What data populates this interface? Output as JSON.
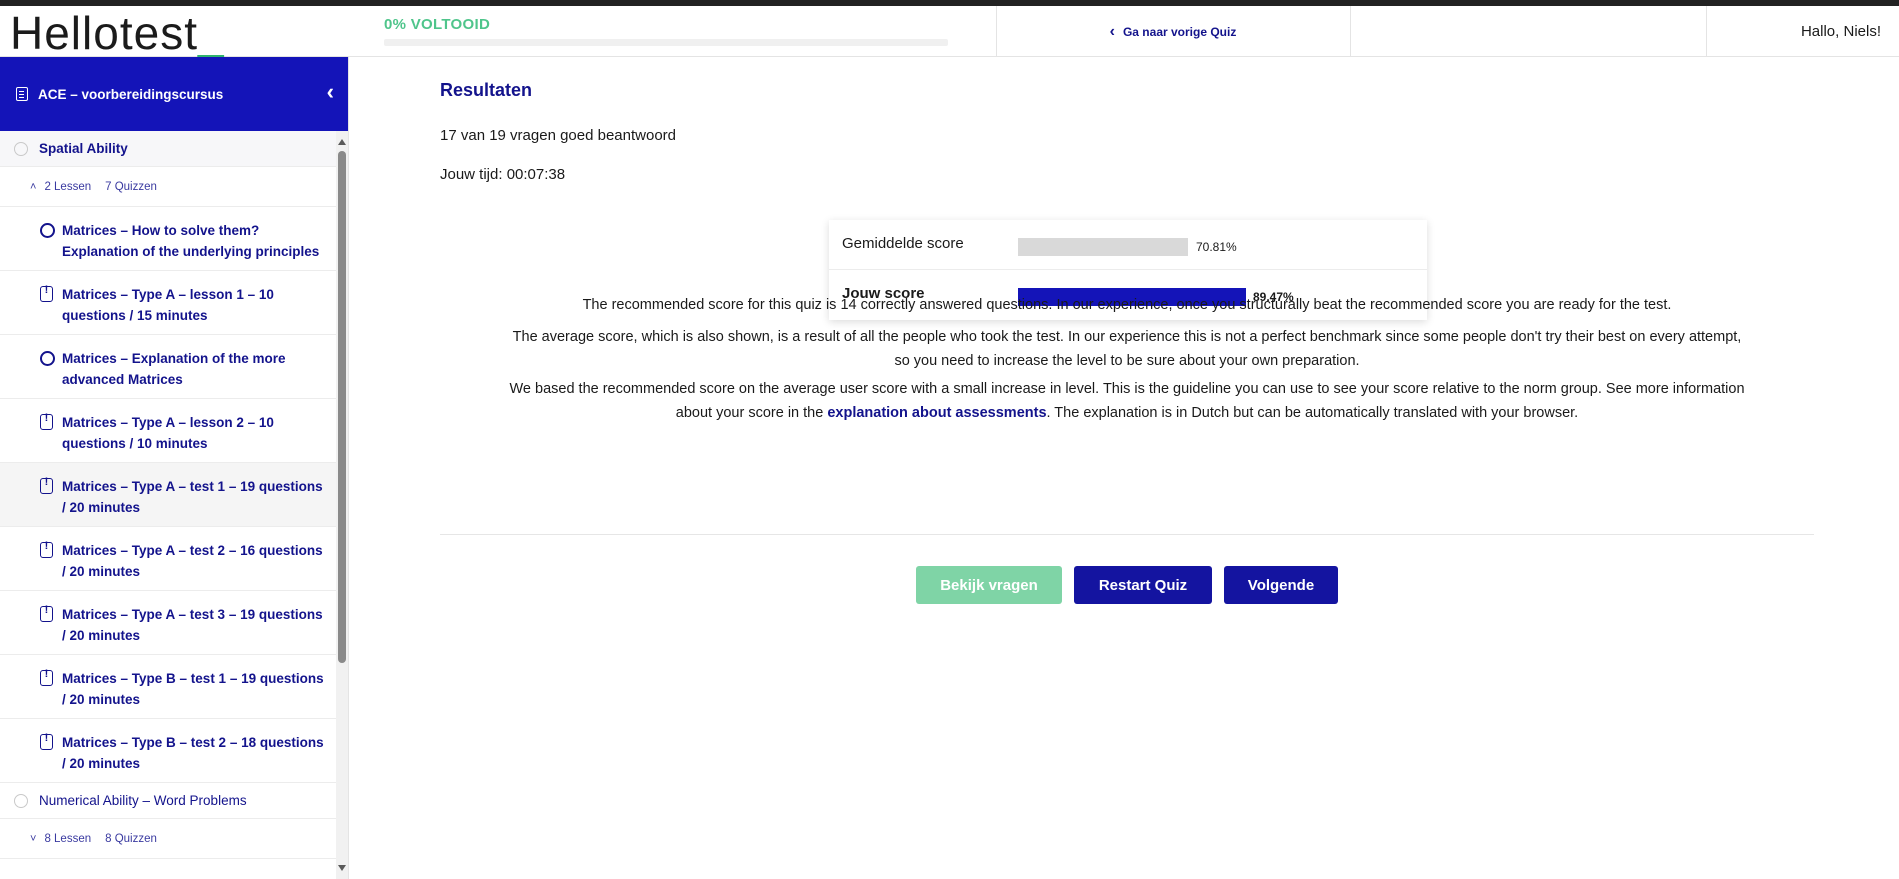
{
  "header": {
    "logo": "Hellotest",
    "logo_suffix": "_",
    "progress_label": "0% VOLTOOID",
    "progress_percent": 0,
    "prev_quiz_label": "Ga naar vorige Quiz",
    "greeting": "Hallo, Niels!"
  },
  "sidebar": {
    "course_title": "ACE – voorbereidingscursus",
    "sections": [
      {
        "title": "Spatial Ability",
        "meta_lessons": "2 Lessen",
        "meta_quizzes": "7 Quizzen",
        "items": [
          {
            "type": "lesson",
            "label": "Matrices – How to solve them? Explanation of the underlying principles"
          },
          {
            "type": "quiz",
            "label": "Matrices – Type A – lesson 1 – 10 questions / 15 minutes"
          },
          {
            "type": "lesson",
            "label": "Matrices – Explanation of the more advanced Matrices"
          },
          {
            "type": "quiz",
            "label": "Matrices – Type A – lesson 2 – 10 questions / 10 minutes"
          },
          {
            "type": "quiz",
            "label": "Matrices – Type A – test 1 – 19 questions / 20 minutes",
            "active": true
          },
          {
            "type": "quiz",
            "label": "Matrices – Type A – test 2 – 16 questions / 20 minutes"
          },
          {
            "type": "quiz",
            "label": "Matrices – Type A – test 3 – 19 questions / 20 minutes"
          },
          {
            "type": "quiz",
            "label": "Matrices – Type B – test 1 – 19 questions / 20 minutes"
          },
          {
            "type": "quiz",
            "label": "Matrices – Type B – test 2 – 18 questions / 20 minutes"
          }
        ]
      },
      {
        "title": "Numerical Ability – Word Problems",
        "meta_lessons": "8 Lessen",
        "meta_quizzes": "8 Quizzen"
      }
    ]
  },
  "results": {
    "title": "Resultaten",
    "correct_line": "17 van 19 vragen goed beantwoord",
    "time_line": "Jouw tijd: 00:07:38",
    "average": {
      "label": "Gemiddelde score",
      "value": 70.81,
      "display": "70.81%"
    },
    "yours": {
      "label": "Jouw score",
      "value": 89.47,
      "display": "89.47%"
    },
    "paragraph1": "The recommended score for this quiz is 14 correctly answered questions. In our experience, once you structurally beat the recommended score you are ready for the test.",
    "paragraph2_line1": "The average score, which is also shown, is a result of all the people who took the test. In our experience this is not a perfect benchmark since some people don't try their best on every attempt,",
    "paragraph2_line2": "so you need to increase the level to be sure about your own preparation.",
    "paragraph3_line1": "We based the recommended score on the average user score with a small increase in level. This is the guideline you can use to see your score relative to the norm group. See more information",
    "paragraph3_pre_link": "about your score in the ",
    "paragraph3_link": "explanation about assessments",
    "paragraph3_post_link": ". The explanation is in Dutch but can be automatically translated with your browser."
  },
  "buttons": {
    "review": "Bekijk vragen",
    "restart": "Restart Quiz",
    "next": "Volgende"
  },
  "colors": {
    "brand_blue": "#1414b8",
    "link_blue": "#13138c",
    "green": "#4fc58b"
  }
}
